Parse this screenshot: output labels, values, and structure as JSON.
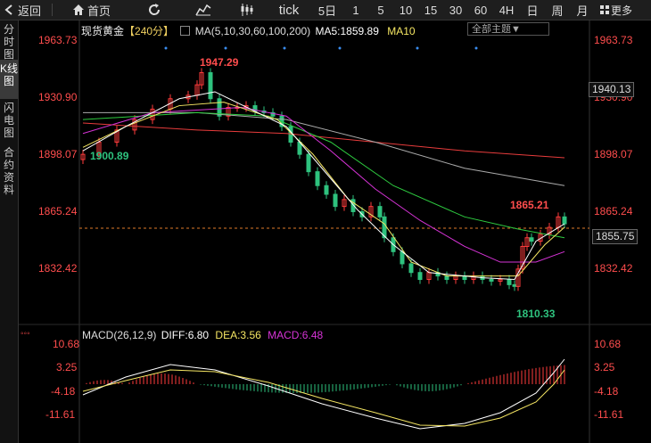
{
  "toolbar": {
    "back": "返回",
    "home": "首页",
    "tick": "tick",
    "periods": [
      "5日",
      "1",
      "5",
      "10",
      "15",
      "30",
      "60",
      "4H",
      "日",
      "周",
      "月"
    ],
    "more": "更多"
  },
  "sidebar": {
    "tabs": [
      {
        "label": "分时图",
        "active": false
      },
      {
        "label": "K线图",
        "active": true
      },
      {
        "label": "闪电图",
        "active": false
      },
      {
        "label": "合约资料",
        "active": false
      }
    ]
  },
  "main_chart": {
    "instrument": "现货黄金",
    "period": "【240分】",
    "ma_legend": "MA(5,10,30,60,100,200)",
    "ma5": "MA5:1859.89",
    "ma10": "MA10",
    "theme_select": "全部主题▼",
    "y_labels": [
      "1963.73",
      "1930.90",
      "1898.07",
      "1865.24",
      "1832.42"
    ],
    "current_price_box": "1940.13",
    "last_price_tag": "1855.75",
    "annotations": {
      "high": "1947.29",
      "low_left": "1900.89",
      "high_right": "1865.21",
      "low": "1810.33"
    }
  },
  "macd": {
    "label": "MACD(26,12,9)",
    "diff": "DIFF:6.80",
    "dea": "DEA:3.56",
    "macd": "MACD:6.48",
    "y_labels": [
      "10.68",
      "3.25",
      "-4.18",
      "-11.61"
    ]
  },
  "colors": {
    "up": "#ff3b3b",
    "down": "#2ec27e",
    "ma5": "#ffffff",
    "ma10": "#f5e663",
    "ma30": "#d633d6",
    "ma60": "#2ecc40",
    "ma100": "#aaaaaa",
    "ma200": "#e83c3c"
  }
}
